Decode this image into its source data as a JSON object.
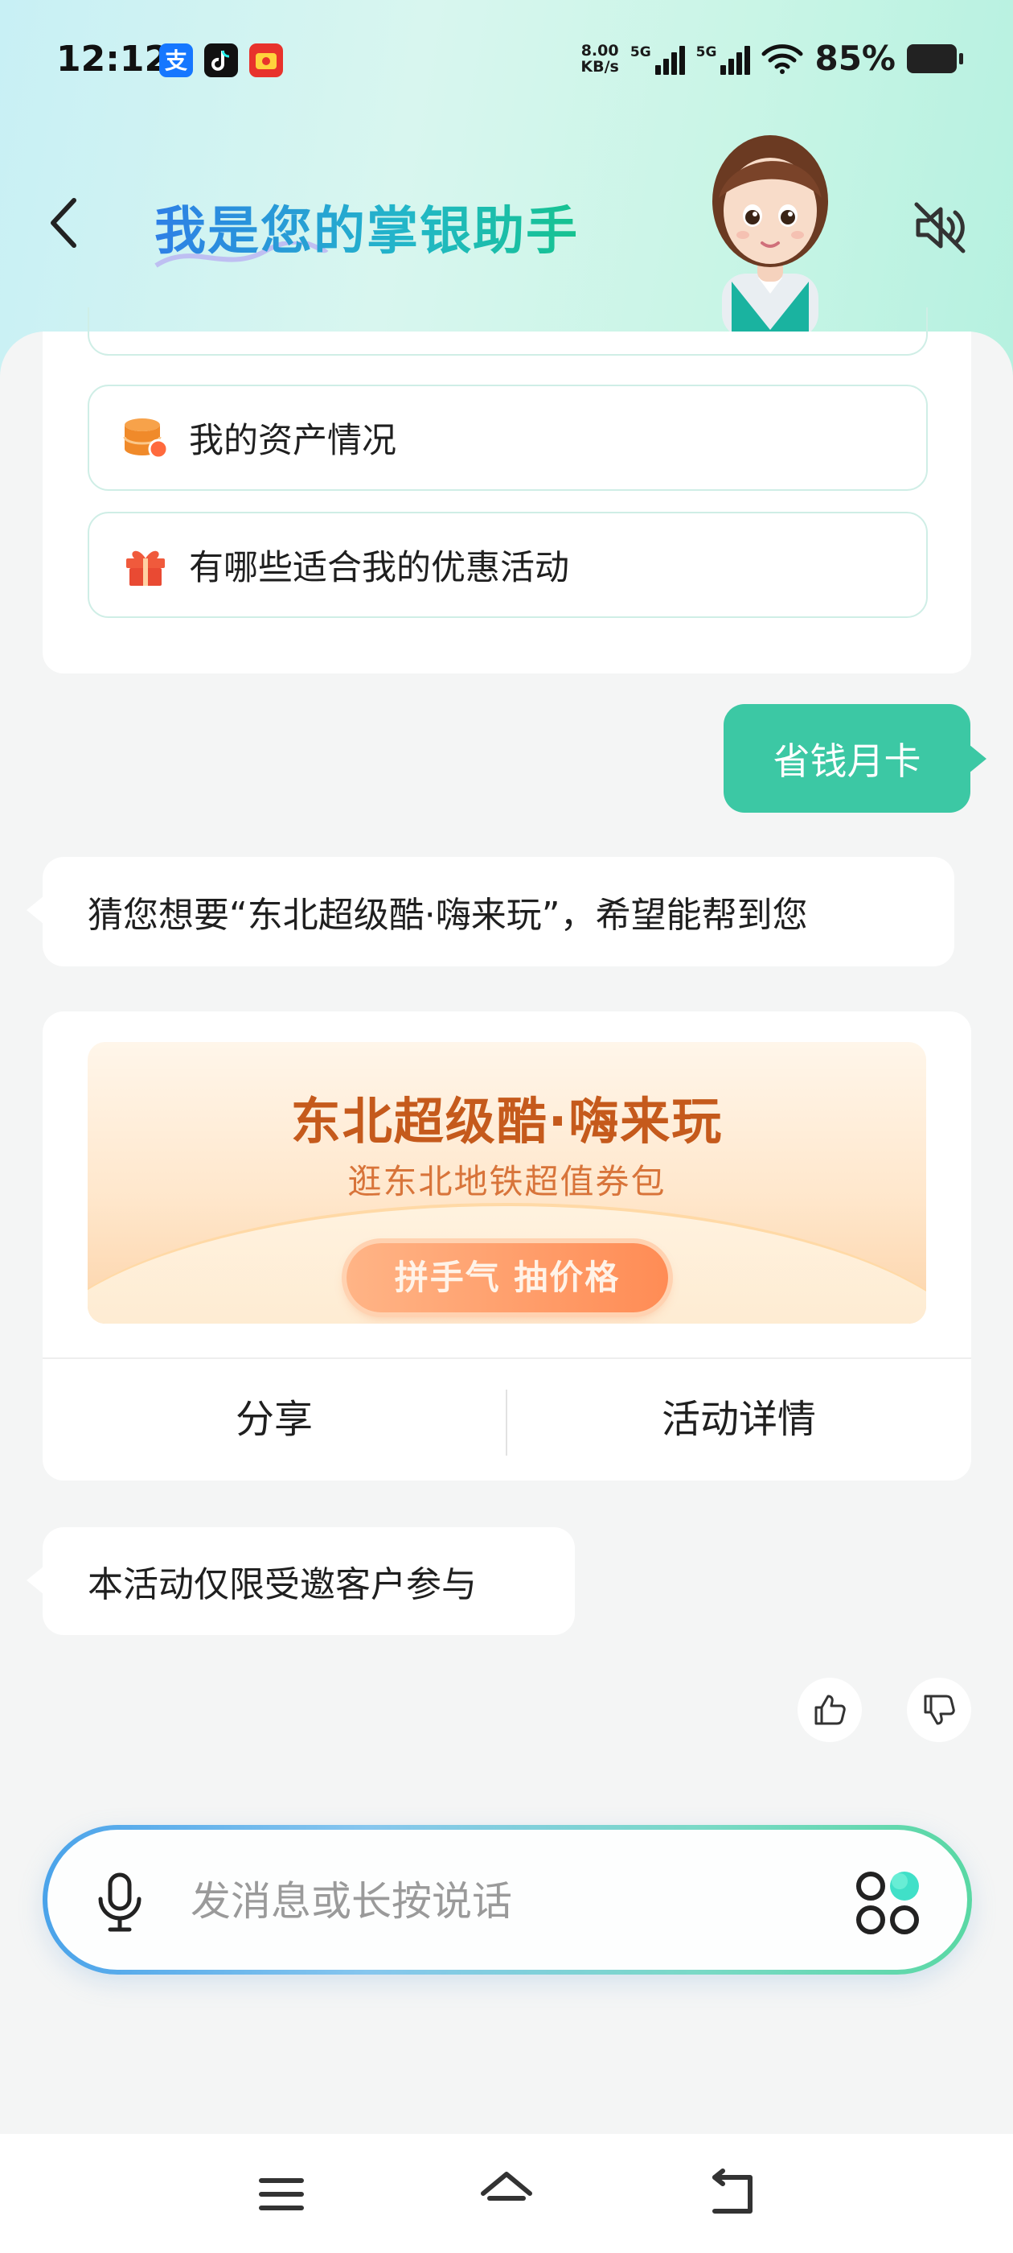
{
  "status_bar": {
    "time": "12:12",
    "net_speed_value": "8.00",
    "net_speed_unit": "KB/s",
    "sim1_label": "5G",
    "sim2_label": "5G",
    "battery": "85%"
  },
  "header": {
    "title": "我是您的掌银助手"
  },
  "suggestions": [
    {
      "label": "我的资产情况",
      "icon": "database-coin-icon"
    },
    {
      "label": "有哪些适合我的优惠活动",
      "icon": "gift-icon"
    }
  ],
  "chat": {
    "user_message": "省钱月卡",
    "bot_reply": "猜您想要“东北超级酷·嗨来玩”，希望能帮到您",
    "activity": {
      "title": "东北超级酷·嗨来玩",
      "subtitle": "逛东北地铁超值券包",
      "cta": "拼手气 抽价格",
      "share_label": "分享",
      "details_label": "活动详情"
    },
    "notice": "本活动仅限受邀客户参与"
  },
  "input": {
    "placeholder": "发消息或长按说话"
  },
  "colors": {
    "accent": "#3cc8a4",
    "banner_title": "#c55a1c",
    "title_gradient_start": "#2e7fe6",
    "title_gradient_end": "#16c38f"
  }
}
